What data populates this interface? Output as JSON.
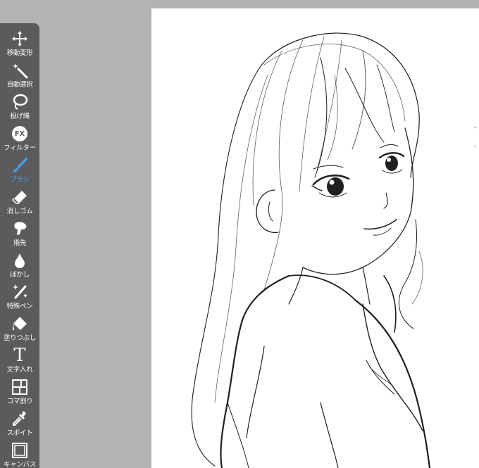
{
  "toolbar": {
    "tools": [
      {
        "label": "移動変形",
        "icon": "move-transform-icon",
        "active": false
      },
      {
        "label": "自動選択",
        "icon": "magic-wand-icon",
        "active": false
      },
      {
        "label": "投げ縄",
        "icon": "lasso-icon",
        "active": false
      },
      {
        "label": "フィルター",
        "icon": "fx-filter-icon",
        "fx_text": "FX",
        "active": false
      },
      {
        "label": "ブラシ",
        "icon": "brush-icon",
        "active": true
      },
      {
        "label": "消しゴム",
        "icon": "eraser-icon",
        "active": false
      },
      {
        "label": "指先",
        "icon": "finger-smudge-icon",
        "active": false
      },
      {
        "label": "ぼかし",
        "icon": "blur-drop-icon",
        "active": false
      },
      {
        "label": "特殊ペン",
        "icon": "special-pen-icon",
        "active": false
      },
      {
        "label": "塗りつぶし",
        "icon": "fill-bucket-icon",
        "active": false
      },
      {
        "label": "文字入れ",
        "icon": "text-icon",
        "glyph": "T",
        "active": false
      },
      {
        "label": "コマ割り",
        "icon": "frame-divide-icon",
        "active": false
      },
      {
        "label": "スポイト",
        "icon": "eyedropper-icon",
        "active": false
      },
      {
        "label": "キャンバス",
        "icon": "canvas-icon",
        "active": false
      }
    ]
  },
  "colors": {
    "toolbar_bg": "#5b5b5d",
    "active_accent": "#4b9cf0",
    "canvas_backdrop": "#b3b3b3",
    "paper": "#ffffff",
    "ink": "#1a1a1a"
  }
}
